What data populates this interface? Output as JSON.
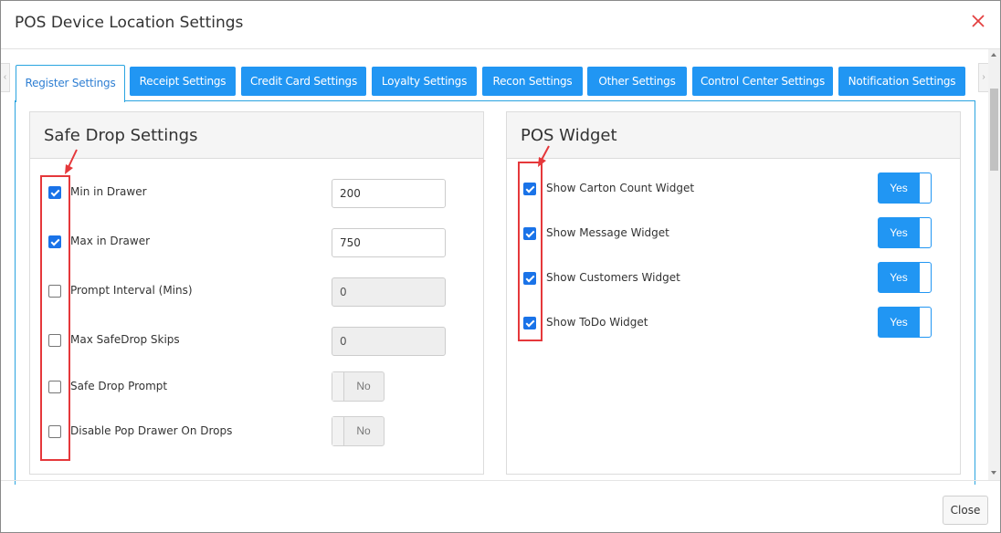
{
  "dialog": {
    "title": "POS Device Location Settings"
  },
  "tabs": [
    {
      "label": "Register Settings",
      "active": true
    },
    {
      "label": "Receipt Settings",
      "active": false
    },
    {
      "label": "Credit Card Settings",
      "active": false
    },
    {
      "label": "Loyalty Settings",
      "active": false
    },
    {
      "label": "Recon Settings",
      "active": false
    },
    {
      "label": "Other Settings",
      "active": false
    },
    {
      "label": "Control Center Settings",
      "active": false
    },
    {
      "label": "Notification Settings",
      "active": false
    }
  ],
  "safe_drop": {
    "title": "Safe Drop Settings",
    "rows": [
      {
        "label": "Min in Drawer",
        "checked": true,
        "control": "input",
        "value": "200",
        "disabled": false
      },
      {
        "label": "Max in Drawer",
        "checked": true,
        "control": "input",
        "value": "750",
        "disabled": false
      },
      {
        "label": "Prompt Interval (Mins)",
        "checked": false,
        "control": "input",
        "value": "0",
        "disabled": true
      },
      {
        "label": "Max SafeDrop Skips",
        "checked": false,
        "control": "input",
        "value": "0",
        "disabled": true
      },
      {
        "label": "Safe Drop Prompt",
        "checked": false,
        "control": "toggle",
        "value": "No",
        "disabled": true
      },
      {
        "label": "Disable Pop Drawer On Drops",
        "checked": false,
        "control": "toggle",
        "value": "No",
        "disabled": true
      }
    ]
  },
  "pos_widget": {
    "title": "POS Widget",
    "rows": [
      {
        "label": "Show Carton Count Widget",
        "checked": true,
        "toggle": "Yes"
      },
      {
        "label": "Show Message Widget",
        "checked": true,
        "toggle": "Yes"
      },
      {
        "label": "Show Customers Widget",
        "checked": true,
        "toggle": "Yes"
      },
      {
        "label": "Show ToDo Widget",
        "checked": true,
        "toggle": "Yes"
      }
    ]
  },
  "footer": {
    "close_label": "Close"
  },
  "colors": {
    "accent": "#2196f3",
    "annotation": "#e5383b",
    "checkbox": "#1a73e8"
  },
  "icons": {
    "close": "close-x-icon",
    "annotation": "arrow-annotation"
  }
}
